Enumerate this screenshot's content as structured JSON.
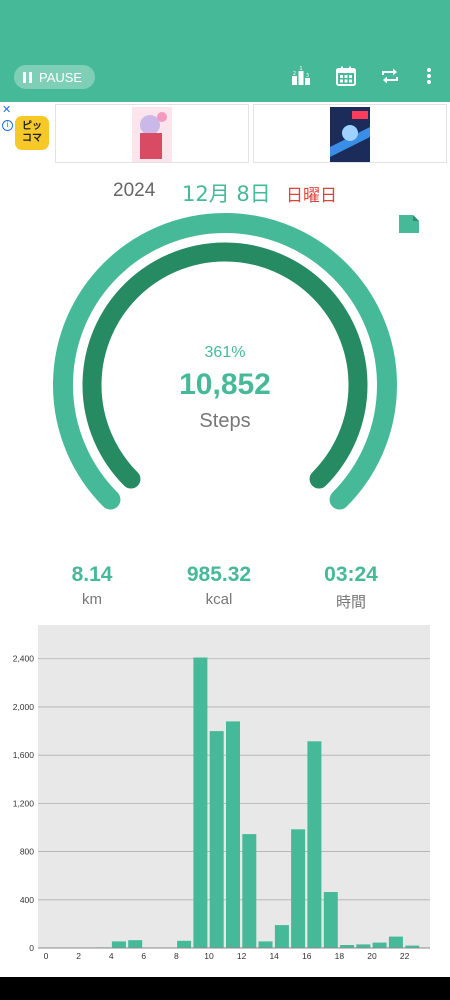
{
  "toolbar": {
    "pause_label": "PAUSE",
    "icons": [
      "ranking-icon",
      "calendar-icon",
      "repeat-icon",
      "more-vert-icon"
    ],
    "color": "#46ba98"
  },
  "ad": {
    "logo_line1": "ピッ",
    "logo_line2": "コマ"
  },
  "date": {
    "year": "2024",
    "month_day": "12月 8日",
    "weekday": "日曜日"
  },
  "gauge": {
    "percent": "361%",
    "progress_fraction": 1.0,
    "steps": "10,852",
    "unit": "Steps"
  },
  "stats": [
    {
      "value": "8.14",
      "unit": "km"
    },
    {
      "value": "985.32",
      "unit": "kcal"
    },
    {
      "value": "03:24",
      "unit": "時間"
    }
  ],
  "chart_data": {
    "type": "bar",
    "x": [
      0,
      1,
      2,
      3,
      4,
      5,
      6,
      7,
      8,
      9,
      10,
      11,
      12,
      13,
      14,
      15,
      16,
      17,
      18,
      19,
      20,
      21,
      22,
      23
    ],
    "values": [
      0,
      0,
      0,
      5,
      55,
      65,
      0,
      0,
      60,
      2410,
      1800,
      1880,
      945,
      55,
      190,
      985,
      1715,
      465,
      25,
      30,
      45,
      95,
      20,
      0
    ],
    "x_tick_labels": [
      "0",
      "2",
      "4",
      "6",
      "8",
      "10",
      "12",
      "14",
      "16",
      "18",
      "20",
      "22"
    ],
    "y_tick_labels": [
      "0",
      "400",
      "800",
      "1,200",
      "1,600",
      "2,000",
      "2,400"
    ],
    "ylim": [
      0,
      2680
    ],
    "grid": true,
    "bar_color": "#46ba98",
    "background": "#e8e8e8"
  }
}
